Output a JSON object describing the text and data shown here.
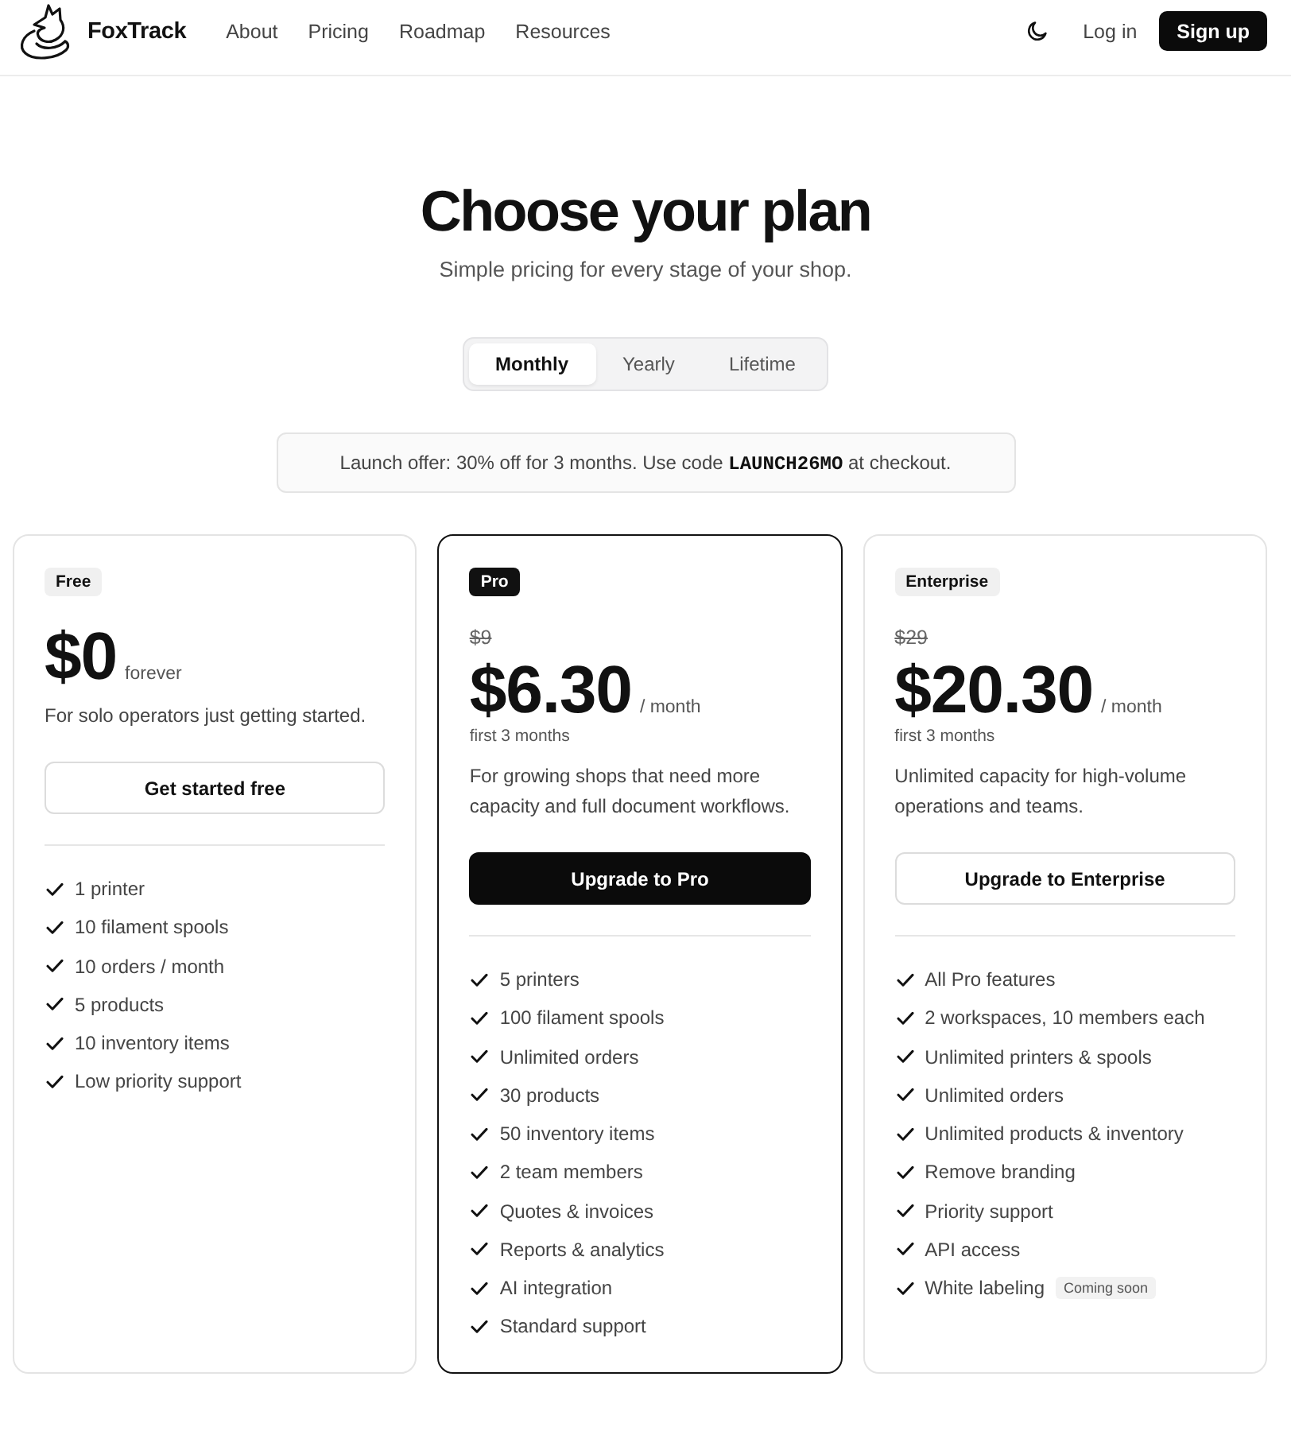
{
  "nav": {
    "brand": "FoxTrack",
    "links": [
      "About",
      "Pricing",
      "Roadmap",
      "Resources"
    ],
    "login": "Log in",
    "signup": "Sign up"
  },
  "hero": {
    "title": "Choose your plan",
    "subtitle": "Simple pricing for every stage of your shop."
  },
  "billing_tabs": [
    {
      "label": "Monthly",
      "selected": true
    },
    {
      "label": "Yearly",
      "selected": false
    },
    {
      "label": "Lifetime",
      "selected": false
    }
  ],
  "promo": {
    "text": "Launch offer: 30% off for 3 months. Use code **LAUNCH26MO** at checkout."
  },
  "plans": [
    {
      "badge": "Free",
      "featured": false,
      "price": "$0",
      "period": "forever",
      "description": "For solo operators just getting started.",
      "button": "Get started free",
      "features": [
        {
          "text": "1 printer"
        },
        {
          "text": "10 filament spools"
        },
        {
          "text": "10 orders / month"
        },
        {
          "text": "5 products"
        },
        {
          "text": "10 inventory items"
        },
        {
          "text": "Low priority support"
        }
      ]
    },
    {
      "badge": "Pro",
      "featured": true,
      "old_price": "$9",
      "price": "$6.30",
      "period": "/ month",
      "note": "first 3 months",
      "description": "For growing shops that need more capacity and full document workflows.",
      "button": "Upgrade to Pro",
      "features": [
        {
          "text": "5 printers"
        },
        {
          "text": "100 filament spools"
        },
        {
          "text": "Unlimited orders"
        },
        {
          "text": "30 products"
        },
        {
          "text": "50 inventory items"
        },
        {
          "text": "2 team members"
        },
        {
          "text": "Quotes & invoices"
        },
        {
          "text": "Reports & analytics"
        },
        {
          "text": "AI integration"
        },
        {
          "text": "Standard support"
        }
      ]
    },
    {
      "badge": "Enterprise",
      "featured": false,
      "old_price": "$29",
      "price": "$20.30",
      "period": "/ month",
      "note": "first 3 months",
      "description": "Unlimited capacity for high-volume operations and teams.",
      "button": "Upgrade to Enterprise",
      "features": [
        {
          "text": "All Pro features"
        },
        {
          "text": "2 workspaces, 10 members each"
        },
        {
          "text": "Unlimited printers & spools"
        },
        {
          "text": "Unlimited orders"
        },
        {
          "text": "Unlimited products & inventory"
        },
        {
          "text": "Remove branding"
        },
        {
          "text": "Priority support"
        },
        {
          "text": "API access"
        },
        {
          "text": "White labeling",
          "tag": "Coming soon"
        }
      ]
    }
  ]
}
